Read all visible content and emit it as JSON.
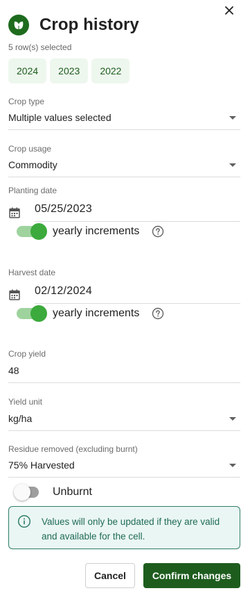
{
  "dialog": {
    "title": "Crop history",
    "selected_count": "5 row(s) selected",
    "close_icon": "close-icon",
    "logo_icon": "leaf-icon"
  },
  "years": [
    "2024",
    "2023",
    "2022"
  ],
  "fields": {
    "crop_type": {
      "label": "Crop type",
      "value": "Multiple values selected"
    },
    "crop_usage": {
      "label": "Crop usage",
      "value": "Commodity"
    },
    "planting_date": {
      "label": "Planting date",
      "value": "05/25/2023",
      "toggle_label": "yearly increments",
      "toggle_on": true
    },
    "harvest_date": {
      "label": "Harvest date",
      "value": "02/12/2024",
      "toggle_label": "yearly increments",
      "toggle_on": true
    },
    "crop_yield": {
      "label": "Crop yield",
      "value": "48"
    },
    "yield_unit": {
      "label": "Yield unit",
      "value": "kg/ha"
    },
    "residue_removed": {
      "label": "Residue removed (excluding burnt)",
      "value": "75% Harvested"
    },
    "unburnt": {
      "label": "Unburnt",
      "toggle_on": false
    }
  },
  "notice": {
    "text": "Values will only be updated if they are valid and available for the cell.",
    "icon": "info-icon"
  },
  "actions": {
    "cancel_label": "Cancel",
    "confirm_label": "Confirm changes"
  },
  "colors": {
    "brand_green": "#1e5c1e",
    "chip_bg": "#eef7ee",
    "switch_on": "#3caa3c",
    "notice_border": "#2f7d69",
    "notice_bg": "#eaf6f3"
  }
}
